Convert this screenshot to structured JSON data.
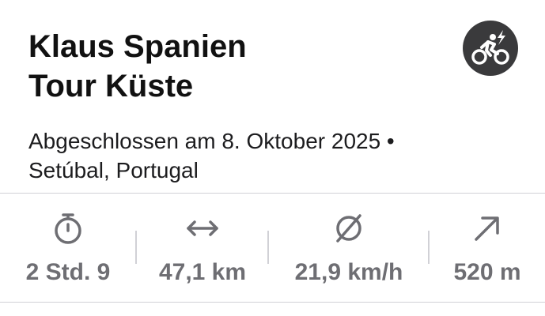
{
  "header": {
    "title_line1": "Klaus Spanien",
    "title_line2": "Tour Küste",
    "activity_icon": "e-bike-icon"
  },
  "subtitle": {
    "line1": "Abgeschlossen am 8. Oktober 2025 •",
    "line2": "Setúbal, Portugal"
  },
  "stats": [
    {
      "icon": "stopwatch-icon",
      "value": "2 Std. 9"
    },
    {
      "icon": "distance-arrows-icon",
      "value": "47,1 km"
    },
    {
      "icon": "average-speed-icon",
      "value": "21,9 km/h"
    },
    {
      "icon": "elevation-arrow-icon",
      "value": "520 m"
    }
  ],
  "colors": {
    "icon_badge": "#3a3a3c",
    "stat_gray": "#6e6e73",
    "divider": "#d1d1d6"
  }
}
